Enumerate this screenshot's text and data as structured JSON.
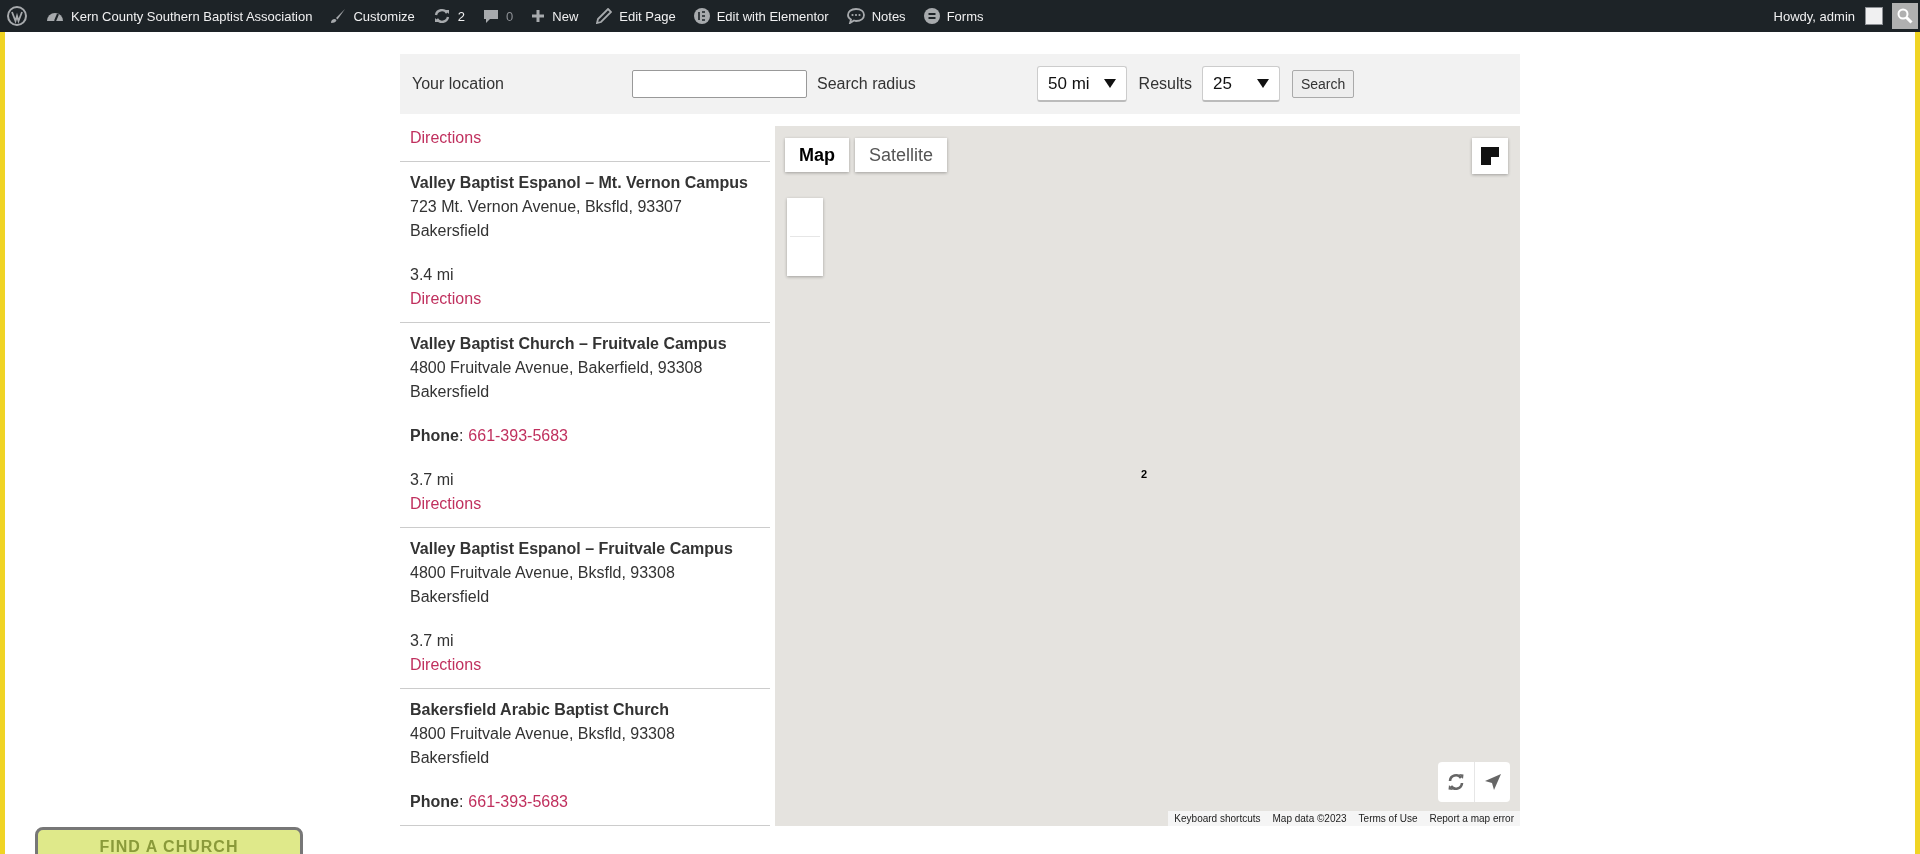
{
  "admin_bar": {
    "items": [
      {
        "kind": "wp"
      },
      {
        "kind": "site",
        "label": "Kern County Southern Baptist Association"
      },
      {
        "kind": "customize",
        "label": "Customize"
      },
      {
        "kind": "updates",
        "label": "2"
      },
      {
        "kind": "comments",
        "label": "0"
      },
      {
        "kind": "new",
        "label": "New"
      },
      {
        "kind": "edit",
        "label": "Edit Page"
      },
      {
        "kind": "elementor",
        "label": "Edit with Elementor"
      },
      {
        "kind": "notes",
        "label": "Notes"
      },
      {
        "kind": "forms",
        "label": "Forms"
      }
    ],
    "greeting": "Howdy, admin"
  },
  "search": {
    "location_label": "Your location",
    "radius_label": "Search radius",
    "radius_value": "50 mi",
    "results_label": "Results",
    "results_value": "25",
    "button": "Search"
  },
  "results": [
    {
      "directions": "Directions"
    },
    {
      "name": "Valley Baptist Espanol – Mt. Vernon Campus",
      "address": "723 Mt. Vernon Avenue, Bksfld, 93307",
      "city": "Bakersfield",
      "distance": "3.4 mi",
      "directions": "Directions"
    },
    {
      "name": "Valley Baptist Church – Fruitvale Campus",
      "address": "4800 Fruitvale Avenue, Bakerfield, 93308",
      "city": "Bakersfield",
      "phone_label": "**Phone**:",
      "phone": "661-393-5683",
      "distance": "3.7 mi",
      "directions": "Directions"
    },
    {
      "name": "Valley Baptist Espanol – Fruitvale Campus",
      "address": "4800 Fruitvale Avenue, Bksfld, 93308",
      "city": "Bakersfield",
      "distance": "3.7 mi",
      "directions": "Directions"
    },
    {
      "name": "Bakersfield Arabic Baptist Church",
      "address": "4800 Fruitvale Avenue, Bksfld, 93308",
      "city": "Bakersfield",
      "phone_label": "**Phone**:",
      "phone": "661-393-5683"
    }
  ],
  "map": {
    "types": [
      {
        "label": "Map",
        "selected": true
      },
      {
        "label": "Satellite",
        "selected": false
      }
    ],
    "cluster_label": "2",
    "footer": [
      "Keyboard shortcuts",
      "Map data ©2023",
      "Terms of Use",
      "Report a map error"
    ]
  },
  "find_button": "FIND A CHURCH"
}
